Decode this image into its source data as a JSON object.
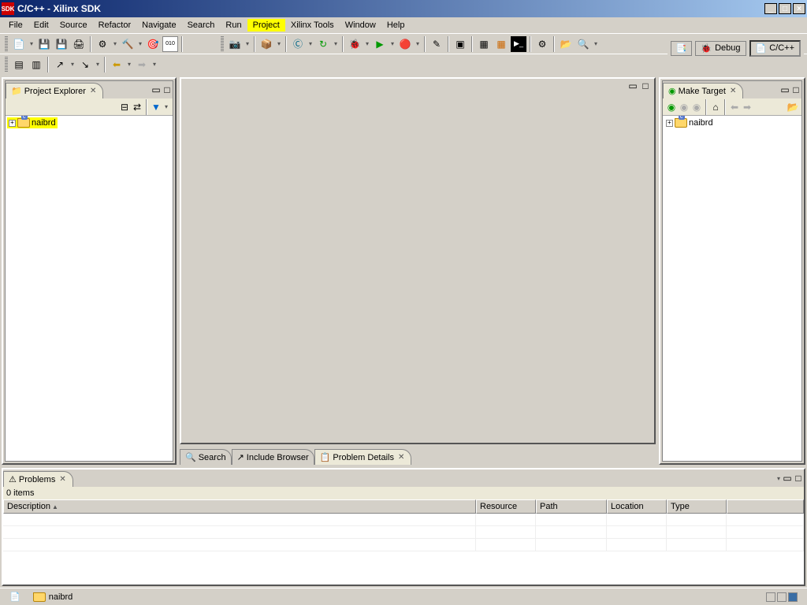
{
  "window": {
    "title": "C/C++ - Xilinx SDK",
    "icon_text": "SDK"
  },
  "menu": {
    "items": [
      "File",
      "Edit",
      "Source",
      "Refactor",
      "Navigate",
      "Search",
      "Run",
      "Project",
      "Xilinx Tools",
      "Window",
      "Help"
    ],
    "highlighted": "Project"
  },
  "perspectives": {
    "debug": "Debug",
    "cpp": "C/C++"
  },
  "project_explorer": {
    "title": "Project Explorer",
    "root": "naibrd"
  },
  "make_target": {
    "title": "Make Target",
    "root": "naibrd"
  },
  "tabs_lower": {
    "search": "Search",
    "include": "Include Browser",
    "problem_details": "Problem Details"
  },
  "problems": {
    "title": "Problems",
    "count": "0 items",
    "columns": {
      "description": "Description",
      "resource": "Resource",
      "path": "Path",
      "location": "Location",
      "type": "Type"
    }
  },
  "status": {
    "project": "naibrd"
  }
}
